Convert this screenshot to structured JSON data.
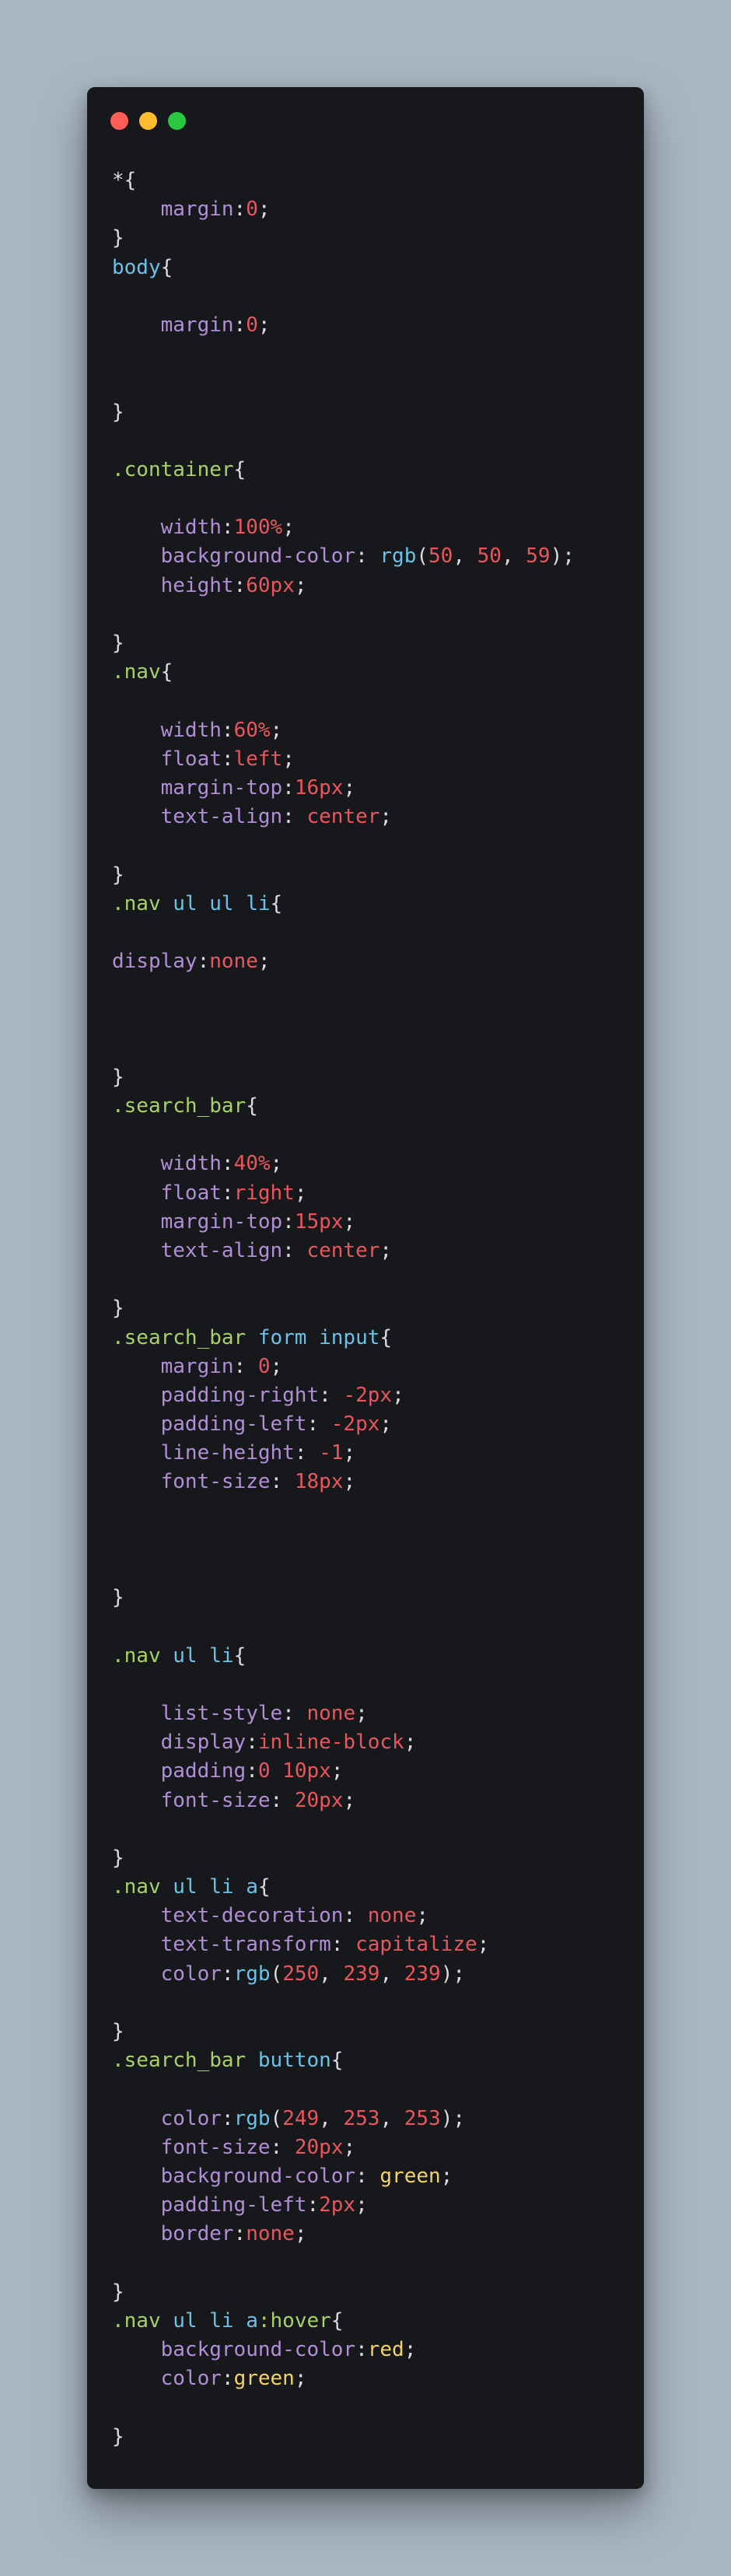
{
  "colors": {
    "background": "#a9b6c2",
    "window": "#17181b",
    "close": "#ff5f57",
    "minimize": "#febc2e",
    "maximize": "#28c840"
  },
  "window_controls": [
    {
      "name": "close-button",
      "color": "#ff5f57"
    },
    {
      "name": "minimize-button",
      "color": "#febc2e"
    },
    {
      "name": "maximize-button",
      "color": "#28c840"
    }
  ],
  "code_lines": [
    [
      [
        "plain",
        "*{"
      ]
    ],
    [
      [
        "plain",
        "    "
      ],
      [
        "prop",
        "margin"
      ],
      [
        "punc",
        ":"
      ],
      [
        "num",
        "0"
      ],
      [
        "punc",
        ";"
      ]
    ],
    [
      [
        "punc",
        "}"
      ]
    ],
    [
      [
        "tag",
        "body"
      ],
      [
        "punc",
        "{"
      ]
    ],
    [],
    [
      [
        "plain",
        "    "
      ],
      [
        "prop",
        "margin"
      ],
      [
        "punc",
        ":"
      ],
      [
        "num",
        "0"
      ],
      [
        "punc",
        ";"
      ]
    ],
    [],
    [],
    [
      [
        "punc",
        "}"
      ]
    ],
    [],
    [
      [
        "sel",
        ".container"
      ],
      [
        "punc",
        "{"
      ]
    ],
    [],
    [
      [
        "plain",
        "    "
      ],
      [
        "prop",
        "width"
      ],
      [
        "punc",
        ":"
      ],
      [
        "num",
        "100%"
      ],
      [
        "punc",
        ";"
      ]
    ],
    [
      [
        "plain",
        "    "
      ],
      [
        "prop",
        "background-color"
      ],
      [
        "punc",
        ": "
      ],
      [
        "fn",
        "rgb"
      ],
      [
        "punc",
        "("
      ],
      [
        "num",
        "50"
      ],
      [
        "punc",
        ", "
      ],
      [
        "num",
        "50"
      ],
      [
        "punc",
        ", "
      ],
      [
        "num",
        "59"
      ],
      [
        "punc",
        ");"
      ]
    ],
    [
      [
        "plain",
        "    "
      ],
      [
        "prop",
        "height"
      ],
      [
        "punc",
        ":"
      ],
      [
        "num",
        "60px"
      ],
      [
        "punc",
        ";"
      ]
    ],
    [],
    [
      [
        "punc",
        "}"
      ]
    ],
    [
      [
        "sel",
        ".nav"
      ],
      [
        "punc",
        "{"
      ]
    ],
    [],
    [
      [
        "plain",
        "    "
      ],
      [
        "prop",
        "width"
      ],
      [
        "punc",
        ":"
      ],
      [
        "num",
        "60%"
      ],
      [
        "punc",
        ";"
      ]
    ],
    [
      [
        "plain",
        "    "
      ],
      [
        "prop",
        "float"
      ],
      [
        "punc",
        ":"
      ],
      [
        "num",
        "left"
      ],
      [
        "punc",
        ";"
      ]
    ],
    [
      [
        "plain",
        "    "
      ],
      [
        "prop",
        "margin-top"
      ],
      [
        "punc",
        ":"
      ],
      [
        "num",
        "16px"
      ],
      [
        "punc",
        ";"
      ]
    ],
    [
      [
        "plain",
        "    "
      ],
      [
        "prop",
        "text-align"
      ],
      [
        "punc",
        ": "
      ],
      [
        "num",
        "center"
      ],
      [
        "punc",
        ";"
      ]
    ],
    [],
    [
      [
        "punc",
        "}"
      ]
    ],
    [
      [
        "sel",
        ".nav"
      ],
      [
        "plain",
        " "
      ],
      [
        "tag",
        "ul"
      ],
      [
        "plain",
        " "
      ],
      [
        "tag",
        "ul"
      ],
      [
        "plain",
        " "
      ],
      [
        "tag",
        "li"
      ],
      [
        "punc",
        "{"
      ]
    ],
    [],
    [
      [
        "prop",
        "display"
      ],
      [
        "punc",
        ":"
      ],
      [
        "num",
        "none"
      ],
      [
        "punc",
        ";"
      ]
    ],
    [],
    [],
    [],
    [
      [
        "punc",
        "}"
      ]
    ],
    [
      [
        "sel",
        ".search_bar"
      ],
      [
        "punc",
        "{"
      ]
    ],
    [],
    [
      [
        "plain",
        "    "
      ],
      [
        "prop",
        "width"
      ],
      [
        "punc",
        ":"
      ],
      [
        "num",
        "40%"
      ],
      [
        "punc",
        ";"
      ]
    ],
    [
      [
        "plain",
        "    "
      ],
      [
        "prop",
        "float"
      ],
      [
        "punc",
        ":"
      ],
      [
        "num",
        "right"
      ],
      [
        "punc",
        ";"
      ]
    ],
    [
      [
        "plain",
        "    "
      ],
      [
        "prop",
        "margin-top"
      ],
      [
        "punc",
        ":"
      ],
      [
        "num",
        "15px"
      ],
      [
        "punc",
        ";"
      ]
    ],
    [
      [
        "plain",
        "    "
      ],
      [
        "prop",
        "text-align"
      ],
      [
        "punc",
        ": "
      ],
      [
        "num",
        "center"
      ],
      [
        "punc",
        ";"
      ]
    ],
    [],
    [
      [
        "punc",
        "}"
      ]
    ],
    [
      [
        "sel",
        ".search_bar"
      ],
      [
        "plain",
        " "
      ],
      [
        "tag",
        "form"
      ],
      [
        "plain",
        " "
      ],
      [
        "tag",
        "input"
      ],
      [
        "punc",
        "{"
      ]
    ],
    [
      [
        "plain",
        "    "
      ],
      [
        "prop",
        "margin"
      ],
      [
        "punc",
        ": "
      ],
      [
        "num",
        "0"
      ],
      [
        "punc",
        ";"
      ]
    ],
    [
      [
        "plain",
        "    "
      ],
      [
        "prop",
        "padding-right"
      ],
      [
        "punc",
        ": "
      ],
      [
        "num",
        "-2px"
      ],
      [
        "punc",
        ";"
      ]
    ],
    [
      [
        "plain",
        "    "
      ],
      [
        "prop",
        "padding-left"
      ],
      [
        "punc",
        ": "
      ],
      [
        "num",
        "-2px"
      ],
      [
        "punc",
        ";"
      ]
    ],
    [
      [
        "plain",
        "    "
      ],
      [
        "prop",
        "line-height"
      ],
      [
        "punc",
        ": "
      ],
      [
        "num",
        "-1"
      ],
      [
        "punc",
        ";"
      ]
    ],
    [
      [
        "plain",
        "    "
      ],
      [
        "prop",
        "font-size"
      ],
      [
        "punc",
        ": "
      ],
      [
        "num",
        "18px"
      ],
      [
        "punc",
        ";"
      ]
    ],
    [],
    [],
    [],
    [
      [
        "punc",
        "}"
      ]
    ],
    [],
    [
      [
        "sel",
        ".nav"
      ],
      [
        "plain",
        " "
      ],
      [
        "tag",
        "ul"
      ],
      [
        "plain",
        " "
      ],
      [
        "tag",
        "li"
      ],
      [
        "punc",
        "{"
      ]
    ],
    [],
    [
      [
        "plain",
        "    "
      ],
      [
        "prop",
        "list-style"
      ],
      [
        "punc",
        ": "
      ],
      [
        "num",
        "none"
      ],
      [
        "punc",
        ";"
      ]
    ],
    [
      [
        "plain",
        "    "
      ],
      [
        "prop",
        "display"
      ],
      [
        "punc",
        ":"
      ],
      [
        "num",
        "inline-block"
      ],
      [
        "punc",
        ";"
      ]
    ],
    [
      [
        "plain",
        "    "
      ],
      [
        "prop",
        "padding"
      ],
      [
        "punc",
        ":"
      ],
      [
        "num",
        "0 10px"
      ],
      [
        "punc",
        ";"
      ]
    ],
    [
      [
        "plain",
        "    "
      ],
      [
        "prop",
        "font-size"
      ],
      [
        "punc",
        ": "
      ],
      [
        "num",
        "20px"
      ],
      [
        "punc",
        ";"
      ]
    ],
    [],
    [
      [
        "punc",
        "}"
      ]
    ],
    [
      [
        "sel",
        ".nav"
      ],
      [
        "plain",
        " "
      ],
      [
        "tag",
        "ul"
      ],
      [
        "plain",
        " "
      ],
      [
        "tag",
        "li"
      ],
      [
        "plain",
        " "
      ],
      [
        "tag",
        "a"
      ],
      [
        "punc",
        "{"
      ]
    ],
    [
      [
        "plain",
        "    "
      ],
      [
        "prop",
        "text-decoration"
      ],
      [
        "punc",
        ": "
      ],
      [
        "num",
        "none"
      ],
      [
        "punc",
        ";"
      ]
    ],
    [
      [
        "plain",
        "    "
      ],
      [
        "prop",
        "text-transform"
      ],
      [
        "punc",
        ": "
      ],
      [
        "num",
        "capitalize"
      ],
      [
        "punc",
        ";"
      ]
    ],
    [
      [
        "plain",
        "    "
      ],
      [
        "prop",
        "color"
      ],
      [
        "punc",
        ":"
      ],
      [
        "fn",
        "rgb"
      ],
      [
        "punc",
        "("
      ],
      [
        "num",
        "250"
      ],
      [
        "punc",
        ", "
      ],
      [
        "num",
        "239"
      ],
      [
        "punc",
        ", "
      ],
      [
        "num",
        "239"
      ],
      [
        "punc",
        ");"
      ]
    ],
    [],
    [
      [
        "punc",
        "}"
      ]
    ],
    [
      [
        "sel",
        ".search_bar"
      ],
      [
        "plain",
        " "
      ],
      [
        "tag",
        "button"
      ],
      [
        "punc",
        "{"
      ]
    ],
    [],
    [
      [
        "plain",
        "    "
      ],
      [
        "prop",
        "color"
      ],
      [
        "punc",
        ":"
      ],
      [
        "fn",
        "rgb"
      ],
      [
        "punc",
        "("
      ],
      [
        "num",
        "249"
      ],
      [
        "punc",
        ", "
      ],
      [
        "num",
        "253"
      ],
      [
        "punc",
        ", "
      ],
      [
        "num",
        "253"
      ],
      [
        "punc",
        ");"
      ]
    ],
    [
      [
        "plain",
        "    "
      ],
      [
        "prop",
        "font-size"
      ],
      [
        "punc",
        ": "
      ],
      [
        "num",
        "20px"
      ],
      [
        "punc",
        ";"
      ]
    ],
    [
      [
        "plain",
        "    "
      ],
      [
        "prop",
        "background-color"
      ],
      [
        "punc",
        ": "
      ],
      [
        "kw",
        "green"
      ],
      [
        "punc",
        ";"
      ]
    ],
    [
      [
        "plain",
        "    "
      ],
      [
        "prop",
        "padding-left"
      ],
      [
        "punc",
        ":"
      ],
      [
        "num",
        "2px"
      ],
      [
        "punc",
        ";"
      ]
    ],
    [
      [
        "plain",
        "    "
      ],
      [
        "prop",
        "border"
      ],
      [
        "punc",
        ":"
      ],
      [
        "num",
        "none"
      ],
      [
        "punc",
        ";"
      ]
    ],
    [],
    [
      [
        "punc",
        "}"
      ]
    ],
    [
      [
        "sel",
        ".nav"
      ],
      [
        "plain",
        " "
      ],
      [
        "tag",
        "ul"
      ],
      [
        "plain",
        " "
      ],
      [
        "tag",
        "li"
      ],
      [
        "plain",
        " "
      ],
      [
        "tag",
        "a"
      ],
      [
        "sel",
        ":hover"
      ],
      [
        "punc",
        "{"
      ]
    ],
    [
      [
        "plain",
        "    "
      ],
      [
        "prop",
        "background-color"
      ],
      [
        "punc",
        ":"
      ],
      [
        "kw",
        "red"
      ],
      [
        "punc",
        ";"
      ]
    ],
    [
      [
        "plain",
        "    "
      ],
      [
        "prop",
        "color"
      ],
      [
        "punc",
        ":"
      ],
      [
        "kw",
        "green"
      ],
      [
        "punc",
        ";"
      ]
    ],
    [],
    [
      [
        "punc",
        "}"
      ]
    ]
  ]
}
